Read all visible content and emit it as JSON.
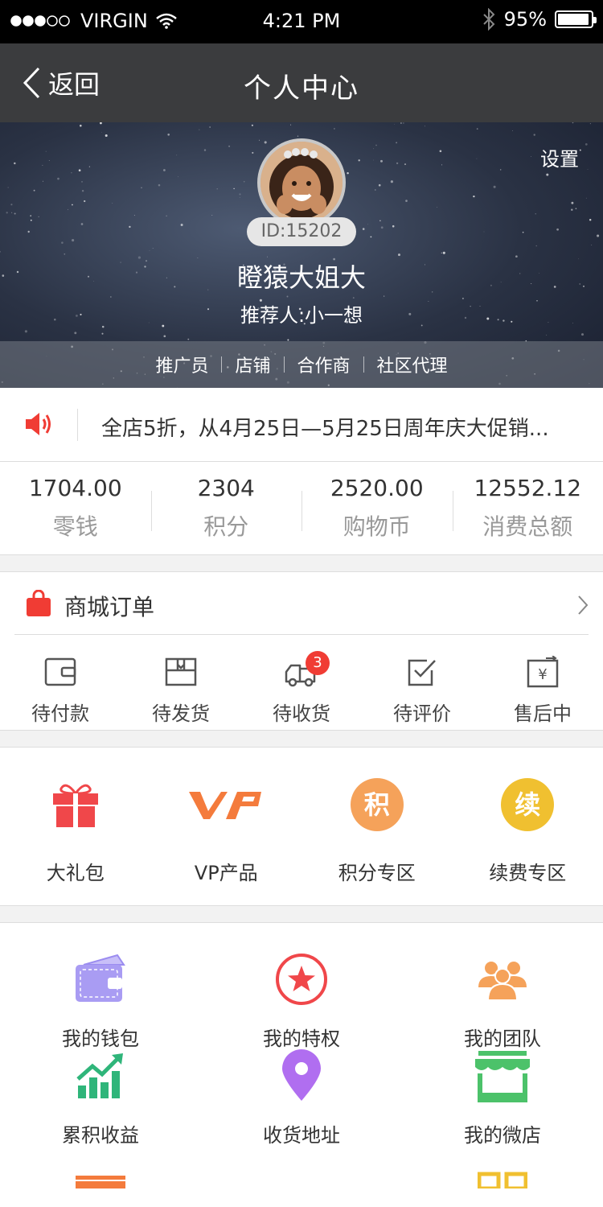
{
  "status_bar": {
    "carrier": "VIRGIN",
    "time": "4:21 PM",
    "battery": "95%",
    "battery_level": 0.95,
    "signal_bars": 3,
    "signal_total": 5
  },
  "nav": {
    "back_label": "返回",
    "title": "个人中心"
  },
  "profile": {
    "settings_label": "设置",
    "id_label": "ID:15202",
    "nickname": "瞪猿大姐大",
    "referrer": "推荐人:小一想",
    "roles": [
      "推广员",
      "店铺",
      "合作商",
      "社区代理"
    ]
  },
  "notice": {
    "text": "全店5折，从4月25日—5月25日周年庆大促销..."
  },
  "stats": [
    {
      "value": "1704.00",
      "label": "零钱"
    },
    {
      "value": "2304",
      "label": "积分"
    },
    {
      "value": "2520.00",
      "label": "购物币"
    },
    {
      "value": "12552.12",
      "label": "消费总额"
    }
  ],
  "orders": {
    "title": "商城订单",
    "items": [
      {
        "label": "待付款",
        "icon": "wallet-outline-icon"
      },
      {
        "label": "待发货",
        "icon": "box-icon"
      },
      {
        "label": "待收货",
        "icon": "truck-icon",
        "badge": "3"
      },
      {
        "label": "待评价",
        "icon": "checkbox-icon"
      },
      {
        "label": "售后中",
        "icon": "yen-exchange-icon"
      }
    ]
  },
  "features": [
    {
      "label": "大礼包",
      "icon": "gift-icon",
      "color": "#f0474a"
    },
    {
      "label": "VP产品",
      "icon": "vp-logo-icon",
      "color": "#f47b3c"
    },
    {
      "label": "积分专区",
      "icon": "points-icon",
      "glyph": "积",
      "color": "#f5a25a"
    },
    {
      "label": "续费专区",
      "icon": "renew-icon",
      "glyph": "续",
      "color": "#f0c030"
    }
  ],
  "menu": [
    {
      "label": "我的钱包",
      "icon": "wallet-icon",
      "color": "#9b8cf0"
    },
    {
      "label": "我的特权",
      "icon": "star-badge-icon",
      "color": "#f0474a"
    },
    {
      "label": "我的团队",
      "icon": "team-icon",
      "color": "#f5a25a"
    },
    {
      "label": "累积收益",
      "icon": "growth-chart-icon",
      "color": "#2fb57a"
    },
    {
      "label": "收货地址",
      "icon": "location-pin-icon",
      "color": "#b06ef0"
    },
    {
      "label": "我的微店",
      "icon": "store-icon",
      "color": "#4cc26a"
    }
  ]
}
